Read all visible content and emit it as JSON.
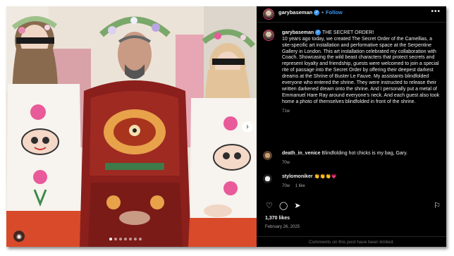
{
  "post": {
    "username": "garybaseman",
    "follow_label": "Follow",
    "more_label": "•••",
    "verified_mark": "✓",
    "caption_title": "THE SECRET ORDER!",
    "caption_text": "10 years ago today, we created The Secret Order of the Camellias, a site-specific art installation and performative space at the Serpentine Gallery in London. This art installation celebrated my collaboration with Coach. Showcasing the wild beast characters that protect secrets and represent loyalty and friendship, guests were welcomed to join a special rite of passage into the Secret Order by offering their deepest darkest dreams at the Shrine of Buster Le Fauve. My assistants blindfolded everyone who entered the shrine. They were instructed to release their written darkened dream onto the shrine. And I personally put a metal of Emmanuel Hare Ray around everyone's neck. And each guest also took home a photo of themselves blindfolded in front of the shrine.",
    "caption_age": "71w",
    "likes": "1,370 likes",
    "date": "February 26, 2025",
    "limited_notice": "Comments on this post have been limited."
  },
  "comments": [
    {
      "user": "death_in_venice",
      "text": "Blindfolding hot chicks is my bag, Gary.",
      "age": "70w",
      "likes": ""
    },
    {
      "user": "stylomoniker",
      "text": "👏👏👏💗",
      "age": "70w",
      "likes": "1 like"
    }
  ],
  "icons": [
    "heart-icon",
    "comment-icon",
    "share-icon",
    "save-icon",
    "user-tag-icon",
    "carousel-next-icon"
  ],
  "colors": {
    "background": "#000000",
    "link": "#3897f0",
    "muted": "#a8a8a8"
  }
}
